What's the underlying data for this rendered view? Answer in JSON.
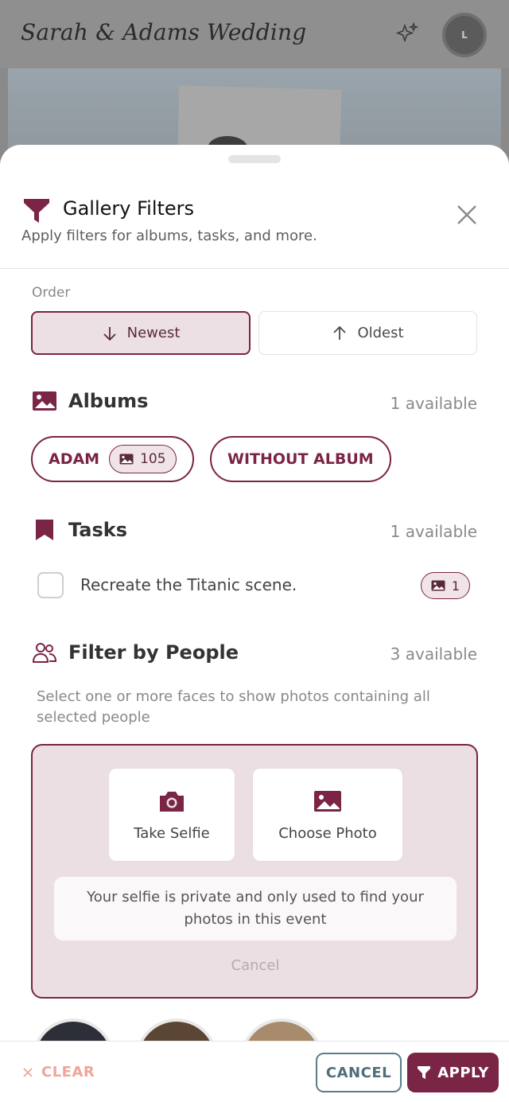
{
  "app": {
    "title": "Sarah & Adams Wedding",
    "avatar_initial": "L"
  },
  "sheet": {
    "title": "Gallery Filters",
    "subtitle": "Apply filters for albums, tasks, and more."
  },
  "order": {
    "label": "Order",
    "newest": "Newest",
    "oldest": "Oldest",
    "selected": "Newest"
  },
  "albums": {
    "title": "Albums",
    "count": "1 available",
    "items": [
      {
        "label": "ADAM",
        "photo_count": "105"
      },
      {
        "label": "WITHOUT ALBUM"
      }
    ]
  },
  "tasks": {
    "title": "Tasks",
    "count": "1 available",
    "items": [
      {
        "label": "Recreate the Titanic scene.",
        "photo_count": "1",
        "checked": false
      }
    ]
  },
  "people": {
    "title": "Filter by People",
    "count": "3 available",
    "description": "Select one or more faces to show photos containing all selected people",
    "take_selfie": "Take Selfie",
    "choose_photo": "Choose Photo",
    "privacy_note": "Your selfie is private and only used to find your photos in this event",
    "cancel": "Cancel"
  },
  "footer": {
    "clear": "CLEAR",
    "cancel": "CANCEL",
    "apply": "APPLY"
  },
  "colors": {
    "accent": "#7a2446",
    "accent_light": "#ebdfe3",
    "clear": "#f0a59a",
    "cancel": "#5b7d87"
  }
}
